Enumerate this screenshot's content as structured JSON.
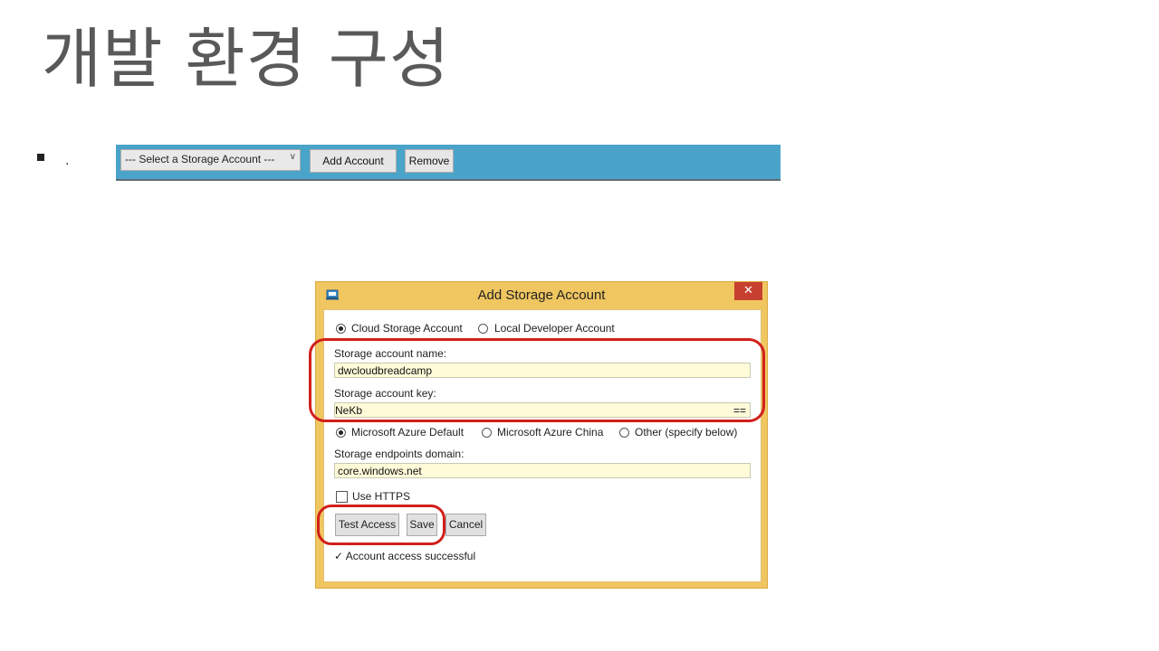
{
  "slide": {
    "title": "개발 환경 구성",
    "bullet_text": "."
  },
  "toolbar": {
    "select_value": "--- Select a Storage Account ---",
    "add_button": "Add Account",
    "remove_button": "Remove",
    "bg_color": "#4aa3c9"
  },
  "dialog": {
    "title": "Add Storage Account",
    "close_glyph": "✕",
    "account_type": {
      "cloud": "Cloud Storage Account",
      "local": "Local Developer Account",
      "selected": "cloud"
    },
    "name_label": "Storage account name:",
    "name_value": "dwcloudbreadcamp",
    "key_label": "Storage account key:",
    "key_value": "NeKb",
    "key_suffix": "==",
    "endpoint_type": {
      "default": "Microsoft Azure Default",
      "china": "Microsoft Azure China",
      "other": "Other (specify below)",
      "selected": "default"
    },
    "domain_label": "Storage endpoints domain:",
    "domain_value": "core.windows.net",
    "https_label": "Use HTTPS",
    "https_checked": false,
    "test_button": "Test Access",
    "save_button": "Save",
    "cancel_button": "Cancel",
    "status_icon": "checkmark-icon",
    "status_check": "✓",
    "status_text": "Account access successful",
    "accent_color": "#f0c660",
    "highlight_color": "#d1201b"
  }
}
